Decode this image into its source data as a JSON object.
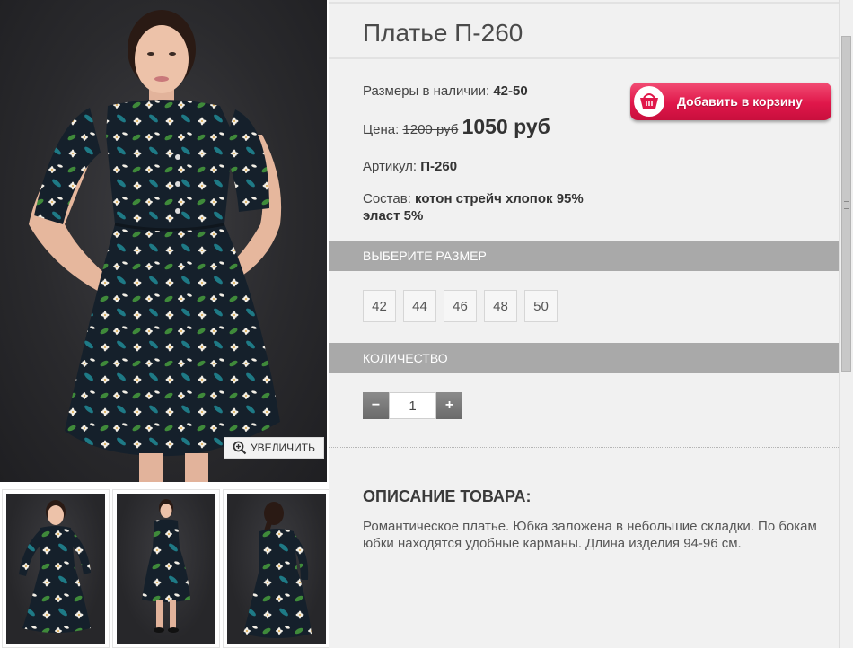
{
  "product": {
    "title": "Платье П-260",
    "sizes_label": "Размеры в наличии:",
    "sizes_value": "42-50",
    "price_label": "Цена:",
    "old_price": "1200 руб",
    "new_price": "1050 руб",
    "article_label": "Артикул:",
    "article_value": "П-260",
    "composition_label": "Состав:",
    "composition_value_line1": "котон стрейч хлопок 95%",
    "composition_value_line2": "эласт 5%"
  },
  "cart_button": {
    "label": "Добавить в корзину",
    "icon": "basket-icon"
  },
  "gallery": {
    "zoom_label": "УВЕЛИЧИТЬ",
    "zoom_icon": "zoom-in-icon",
    "thumbnails": [
      "thumbnail-front",
      "thumbnail-front-full",
      "thumbnail-back"
    ]
  },
  "size_selector": {
    "heading": "ВЫБЕРИТЕ РАЗМЕР",
    "options": [
      "42",
      "44",
      "46",
      "48",
      "50"
    ]
  },
  "quantity": {
    "heading": "КОЛИЧЕСТВО",
    "value": "1",
    "minus": "−",
    "plus": "+"
  },
  "description": {
    "heading": "ОПИСАНИЕ ТОВАРА:",
    "text": "Романтическое платье. Юбка заложена в небольшие складки. По бокам юбки находятся удобные карманы. Длина изделия 94-96 см."
  },
  "colors": {
    "accent": "#e0174a",
    "section_bar": "#a9a9a9",
    "panel_bg": "#f1f1f1"
  }
}
